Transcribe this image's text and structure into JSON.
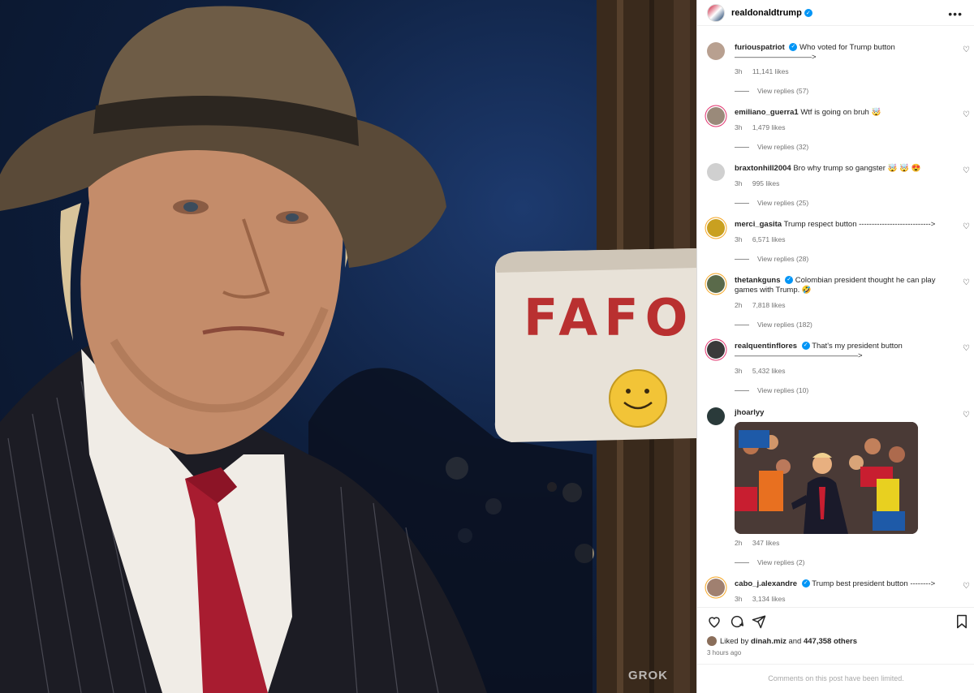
{
  "photo": {
    "sign_text": "FAFO",
    "watermark": "GROK"
  },
  "header": {
    "username": "realdonaldtrump"
  },
  "comments": [
    {
      "user": "furiouspatriot",
      "verified": true,
      "text": "Who voted for Trump button",
      "text2": "——————————>",
      "time": "3h",
      "likes": "11,141 likes",
      "replies": "View replies (57)"
    },
    {
      "user": "emiliano_guerra1",
      "verified": false,
      "text": "Wtf is going on bruh 🤯",
      "time": "3h",
      "likes": "1,479 likes",
      "replies": "View replies (32)"
    },
    {
      "user": "braxtonhill2004",
      "verified": false,
      "text": "Bro why trump so gangster 🤯 🤯 😍",
      "time": "3h",
      "likes": "995 likes",
      "replies": "View replies (25)"
    },
    {
      "user": "merci_gasita",
      "verified": false,
      "text": "Trump respect button ---------------------------->",
      "time": "3h",
      "likes": "6,571 likes",
      "replies": "View replies (28)"
    },
    {
      "user": "thetankguns",
      "verified": true,
      "text": "Colombian president thought he can play games with Trump. 🤣",
      "time": "2h",
      "likes": "7,818 likes",
      "replies": "View replies (182)"
    },
    {
      "user": "realquentinflores",
      "verified": true,
      "text": "That's my president button",
      "text2": "————————————————>",
      "time": "3h",
      "likes": "5,432 likes",
      "replies": "View replies (10)"
    },
    {
      "user": "jhoarlyy",
      "verified": false,
      "text": "",
      "time": "2h",
      "likes": "347 likes",
      "replies": "View replies (2)"
    },
    {
      "user": "cabo_j.alexandre",
      "verified": true,
      "text": "Trump best president button -------->",
      "time": "3h",
      "likes": "3,134 likes"
    }
  ],
  "footer": {
    "liked_prefix": "Liked by",
    "liked_user": "dinah.miz",
    "liked_and": "and",
    "liked_others": "447,358 others",
    "time_ago": "3 hours ago",
    "limited": "Comments on this post have been limited."
  },
  "icons": {
    "verified": "verified-badge-icon",
    "heart": "heart-icon",
    "comment": "comment-icon",
    "share": "send-icon",
    "save": "bookmark-icon",
    "more": "more-options-icon"
  },
  "colors": {
    "verified": "#0095f6",
    "sign_text": "#b93030",
    "secondary_text": "#737373"
  }
}
